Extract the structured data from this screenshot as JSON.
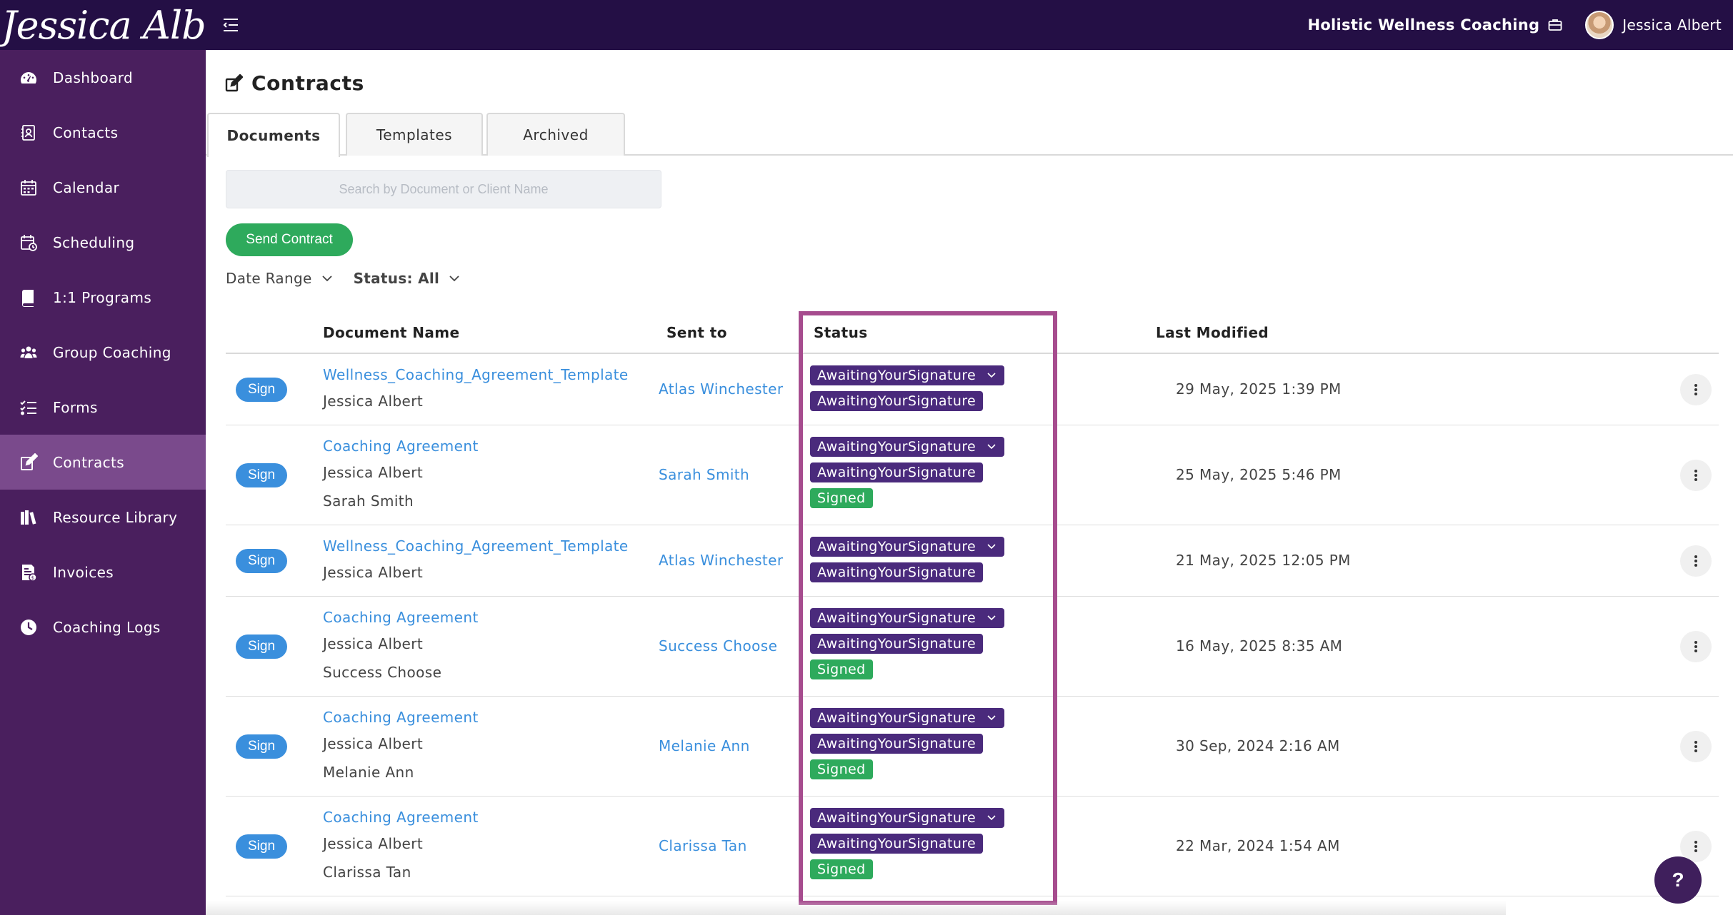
{
  "topbar": {
    "logo_text": "Jessica Albert",
    "business_name": "Holistic Wellness Coaching",
    "user_name": "Jessica Albert"
  },
  "sidebar": {
    "items": [
      {
        "label": "Dashboard",
        "icon": "dashboard-icon"
      },
      {
        "label": "Contacts",
        "icon": "contacts-icon"
      },
      {
        "label": "Calendar",
        "icon": "calendar-icon"
      },
      {
        "label": "Scheduling",
        "icon": "scheduling-icon"
      },
      {
        "label": "1:1 Programs",
        "icon": "book-icon"
      },
      {
        "label": "Group Coaching",
        "icon": "group-icon"
      },
      {
        "label": "Forms",
        "icon": "forms-icon"
      },
      {
        "label": "Contracts",
        "icon": "contract-icon",
        "active": true
      },
      {
        "label": "Resource Library",
        "icon": "library-icon"
      },
      {
        "label": "Invoices",
        "icon": "invoice-icon"
      },
      {
        "label": "Coaching Logs",
        "icon": "clock-icon"
      }
    ]
  },
  "page": {
    "title": "Contracts",
    "tabs": [
      "Documents",
      "Templates",
      "Archived"
    ],
    "active_tab": "Documents",
    "search_placeholder": "Search by Document or Client Name",
    "send_button": "Send Contract",
    "filter_date": "Date Range",
    "filter_status": "Status: All"
  },
  "table": {
    "headers": {
      "document": "Document Name",
      "sent_to": "Sent to",
      "status": "Status",
      "modified": "Last Modified"
    },
    "sign_label": "Sign",
    "rows": [
      {
        "doc": "Wellness_Coaching_Agreement_Template",
        "signers": [
          "Jessica Albert"
        ],
        "sent_to": "Atlas Winchester",
        "statuses": [
          "AwaitingYourSignature",
          "AwaitingYourSignature"
        ],
        "modified": "29 May, 2025 1:39 PM"
      },
      {
        "doc": "Coaching Agreement",
        "signers": [
          "Jessica Albert",
          "Sarah Smith"
        ],
        "sent_to": "Sarah Smith",
        "statuses": [
          "AwaitingYourSignature",
          "AwaitingYourSignature",
          "Signed"
        ],
        "modified": "25 May, 2025 5:46 PM"
      },
      {
        "doc": "Wellness_Coaching_Agreement_Template",
        "signers": [
          "Jessica Albert"
        ],
        "sent_to": "Atlas Winchester",
        "statuses": [
          "AwaitingYourSignature",
          "AwaitingYourSignature"
        ],
        "modified": "21 May, 2025 12:05 PM"
      },
      {
        "doc": "Coaching Agreement",
        "signers": [
          "Jessica Albert",
          "Success Choose"
        ],
        "sent_to": "Success Choose",
        "statuses": [
          "AwaitingYourSignature",
          "AwaitingYourSignature",
          "Signed"
        ],
        "modified": "16 May, 2025 8:35 AM"
      },
      {
        "doc": "Coaching Agreement",
        "signers": [
          "Jessica Albert",
          "Melanie Ann"
        ],
        "sent_to": "Melanie Ann",
        "statuses": [
          "AwaitingYourSignature",
          "AwaitingYourSignature",
          "Signed"
        ],
        "modified": "30 Sep, 2024 2:16 AM"
      },
      {
        "doc": "Coaching Agreement",
        "signers": [
          "Jessica Albert",
          "Clarissa Tan"
        ],
        "sent_to": "Clarissa Tan",
        "statuses": [
          "AwaitingYourSignature",
          "AwaitingYourSignature",
          "Signed"
        ],
        "modified": "22 Mar, 2024 1:54 AM"
      }
    ]
  },
  "help_label": "?",
  "colors": {
    "topbar": "#240f45",
    "sidebar": "#4a1f5e",
    "sidebar_active": "#7a4a8c",
    "link_blue": "#3a8fdd",
    "badge_purple": "#4a2a7c",
    "badge_green": "#2eaa5c",
    "highlight": "#a64c8e"
  }
}
